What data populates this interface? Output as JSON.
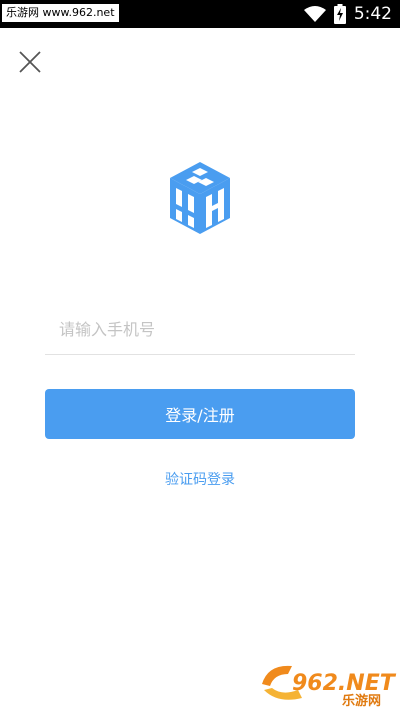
{
  "status_bar": {
    "watermark": "乐游网 www.962.net",
    "time": "5:42"
  },
  "icons": {
    "close": "close-icon",
    "wifi": "wifi-icon",
    "battery": "battery-charging-icon",
    "logo": "app-logo-cube"
  },
  "login": {
    "phone_placeholder": "请输入手机号",
    "submit_label": "登录/注册",
    "code_login_label": "验证码登录"
  },
  "watermark_bottom": {
    "line1": "962.NET",
    "line2": "乐游网"
  },
  "colors": {
    "accent": "#4a9df0",
    "logo": "#4a9df0",
    "status_bar": "#000000"
  }
}
